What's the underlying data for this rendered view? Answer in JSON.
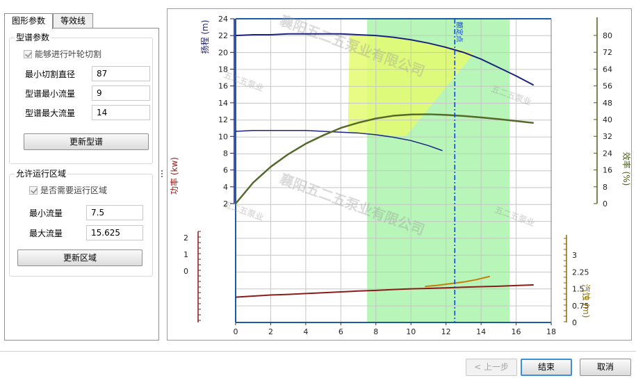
{
  "tabs": [
    "图形参数",
    "等效线"
  ],
  "group_spectrum": {
    "title": "型谱参数",
    "check_label": "能够进行叶轮切割",
    "fields": [
      {
        "label": "最小切割直径",
        "value": "87"
      },
      {
        "label": "型谱最小流量",
        "value": "9"
      },
      {
        "label": "型谱最大流量",
        "value": "14"
      }
    ],
    "button": "更新型谱"
  },
  "group_region": {
    "title": "允许运行区域",
    "check_label": "是否需要运行区域",
    "fields": [
      {
        "label": "最小流量",
        "value": "7.5"
      },
      {
        "label": "最大流量",
        "value": "15.625"
      }
    ],
    "button": "更新区域"
  },
  "bottom_buttons": {
    "prev": "< 上一步",
    "finish": "结束",
    "cancel": "取消"
  },
  "chart_data": {
    "type": "line",
    "watermarks": [
      "襄阳五二五泵业有限公司",
      "五二五泵业"
    ],
    "x_ticks": [
      0,
      2,
      4,
      6,
      8,
      10,
      12,
      14,
      16,
      18
    ],
    "xlim": [
      0,
      18
    ],
    "rated_point_label": "额定点",
    "rated_flow": 12.5,
    "allowed_region": [
      7.5,
      15.625
    ],
    "axes": {
      "head": {
        "label": "扬程 (m)",
        "range": [
          2,
          24
        ],
        "ticks": [
          2,
          4,
          6,
          8,
          10,
          12,
          14,
          16,
          18,
          20,
          22,
          24
        ],
        "color": "#1a1a6e"
      },
      "efficiency": {
        "label": "效率 (%)",
        "range": [
          0,
          80
        ],
        "ticks": [
          0,
          8,
          16,
          24,
          32,
          40,
          48,
          56,
          64,
          72,
          80
        ],
        "color": "#4a5e1a"
      },
      "power": {
        "label": "功率 (kw)",
        "range": [
          -2,
          2
        ],
        "ticks": [
          0,
          1,
          2
        ],
        "color": "#8b1a1a"
      },
      "npsh": {
        "label": "汽蚀 (m)",
        "range": [
          0,
          3
        ],
        "ticks": [
          0,
          0.75,
          1.5,
          2.25,
          3
        ],
        "color": "#8b6a00"
      }
    },
    "series": [
      {
        "name": "head-max",
        "axis": "head",
        "color": "#1a237e",
        "x": [
          0,
          1,
          2,
          3,
          4,
          5,
          6,
          7,
          8,
          9,
          10,
          11,
          12,
          13,
          14,
          15,
          16,
          17
        ],
        "y": [
          22.0,
          22.1,
          22.1,
          22.2,
          22.2,
          22.2,
          22.2,
          22.1,
          22.0,
          21.8,
          21.5,
          21.1,
          20.6,
          20.0,
          19.2,
          18.2,
          17.2,
          16.1
        ]
      },
      {
        "name": "head-min",
        "axis": "head",
        "color": "#1a237e",
        "x": [
          0,
          1,
          2,
          3,
          4,
          5,
          6,
          7,
          8,
          9,
          10,
          11,
          11.8
        ],
        "y": [
          10.6,
          10.7,
          10.7,
          10.7,
          10.7,
          10.6,
          10.5,
          10.4,
          10.2,
          9.9,
          9.5,
          8.9,
          8.3
        ]
      },
      {
        "name": "efficiency",
        "axis": "efficiency",
        "color": "#55692a",
        "x": [
          0,
          1,
          2,
          3,
          4,
          5,
          6,
          7,
          8,
          9,
          10,
          11,
          12,
          13,
          14,
          15,
          16,
          17
        ],
        "y": [
          0,
          10,
          17.5,
          23.5,
          28.5,
          32.5,
          36,
          38.5,
          40.5,
          41.8,
          42.4,
          42.5,
          42.2,
          41.7,
          41,
          40.2,
          39.3,
          38.4
        ]
      },
      {
        "name": "power",
        "axis": "power",
        "color": "#8b1a1a",
        "x": [
          0,
          1,
          2,
          3,
          4,
          5,
          6,
          7,
          8,
          9,
          10,
          11,
          12,
          13,
          14,
          15,
          16,
          17
        ],
        "y": [
          -1.57,
          -1.5,
          -1.44,
          -1.4,
          -1.35,
          -1.3,
          -1.25,
          -1.2,
          -1.16,
          -1.11,
          -1.07,
          -1.04,
          -1.01,
          -0.97,
          -0.94,
          -0.91,
          -0.87,
          -0.83
        ]
      },
      {
        "name": "npsh",
        "axis": "npsh",
        "color": "#c47d0a",
        "x": [
          10.8,
          11.5,
          12.2,
          13,
          13.7,
          14.5
        ],
        "y": [
          1.6,
          1.65,
          1.72,
          1.8,
          1.9,
          2.05
        ]
      }
    ],
    "spectrum_polygon": {
      "x": [
        6.5,
        8,
        9,
        10,
        12.4,
        13.6,
        9.7,
        6.4
      ],
      "head": [
        22.0,
        21.9,
        21.7,
        21.5,
        20.6,
        19.9,
        10.0,
        10.5
      ]
    }
  }
}
